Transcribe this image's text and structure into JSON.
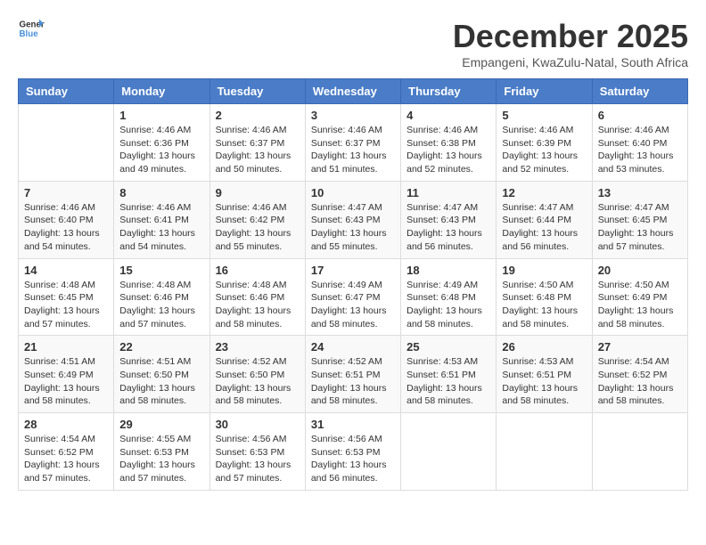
{
  "logo": {
    "general": "General",
    "blue": "Blue"
  },
  "title": "December 2025",
  "location": "Empangeni, KwaZulu-Natal, South Africa",
  "headers": [
    "Sunday",
    "Monday",
    "Tuesday",
    "Wednesday",
    "Thursday",
    "Friday",
    "Saturday"
  ],
  "weeks": [
    [
      {
        "day": "",
        "sunrise": "",
        "sunset": "",
        "daylight": ""
      },
      {
        "day": "1",
        "sunrise": "Sunrise: 4:46 AM",
        "sunset": "Sunset: 6:36 PM",
        "daylight": "Daylight: 13 hours and 49 minutes."
      },
      {
        "day": "2",
        "sunrise": "Sunrise: 4:46 AM",
        "sunset": "Sunset: 6:37 PM",
        "daylight": "Daylight: 13 hours and 50 minutes."
      },
      {
        "day": "3",
        "sunrise": "Sunrise: 4:46 AM",
        "sunset": "Sunset: 6:37 PM",
        "daylight": "Daylight: 13 hours and 51 minutes."
      },
      {
        "day": "4",
        "sunrise": "Sunrise: 4:46 AM",
        "sunset": "Sunset: 6:38 PM",
        "daylight": "Daylight: 13 hours and 52 minutes."
      },
      {
        "day": "5",
        "sunrise": "Sunrise: 4:46 AM",
        "sunset": "Sunset: 6:39 PM",
        "daylight": "Daylight: 13 hours and 52 minutes."
      },
      {
        "day": "6",
        "sunrise": "Sunrise: 4:46 AM",
        "sunset": "Sunset: 6:40 PM",
        "daylight": "Daylight: 13 hours and 53 minutes."
      }
    ],
    [
      {
        "day": "7",
        "sunrise": "Sunrise: 4:46 AM",
        "sunset": "Sunset: 6:40 PM",
        "daylight": "Daylight: 13 hours and 54 minutes."
      },
      {
        "day": "8",
        "sunrise": "Sunrise: 4:46 AM",
        "sunset": "Sunset: 6:41 PM",
        "daylight": "Daylight: 13 hours and 54 minutes."
      },
      {
        "day": "9",
        "sunrise": "Sunrise: 4:46 AM",
        "sunset": "Sunset: 6:42 PM",
        "daylight": "Daylight: 13 hours and 55 minutes."
      },
      {
        "day": "10",
        "sunrise": "Sunrise: 4:47 AM",
        "sunset": "Sunset: 6:43 PM",
        "daylight": "Daylight: 13 hours and 55 minutes."
      },
      {
        "day": "11",
        "sunrise": "Sunrise: 4:47 AM",
        "sunset": "Sunset: 6:43 PM",
        "daylight": "Daylight: 13 hours and 56 minutes."
      },
      {
        "day": "12",
        "sunrise": "Sunrise: 4:47 AM",
        "sunset": "Sunset: 6:44 PM",
        "daylight": "Daylight: 13 hours and 56 minutes."
      },
      {
        "day": "13",
        "sunrise": "Sunrise: 4:47 AM",
        "sunset": "Sunset: 6:45 PM",
        "daylight": "Daylight: 13 hours and 57 minutes."
      }
    ],
    [
      {
        "day": "14",
        "sunrise": "Sunrise: 4:48 AM",
        "sunset": "Sunset: 6:45 PM",
        "daylight": "Daylight: 13 hours and 57 minutes."
      },
      {
        "day": "15",
        "sunrise": "Sunrise: 4:48 AM",
        "sunset": "Sunset: 6:46 PM",
        "daylight": "Daylight: 13 hours and 57 minutes."
      },
      {
        "day": "16",
        "sunrise": "Sunrise: 4:48 AM",
        "sunset": "Sunset: 6:46 PM",
        "daylight": "Daylight: 13 hours and 58 minutes."
      },
      {
        "day": "17",
        "sunrise": "Sunrise: 4:49 AM",
        "sunset": "Sunset: 6:47 PM",
        "daylight": "Daylight: 13 hours and 58 minutes."
      },
      {
        "day": "18",
        "sunrise": "Sunrise: 4:49 AM",
        "sunset": "Sunset: 6:48 PM",
        "daylight": "Daylight: 13 hours and 58 minutes."
      },
      {
        "day": "19",
        "sunrise": "Sunrise: 4:50 AM",
        "sunset": "Sunset: 6:48 PM",
        "daylight": "Daylight: 13 hours and 58 minutes."
      },
      {
        "day": "20",
        "sunrise": "Sunrise: 4:50 AM",
        "sunset": "Sunset: 6:49 PM",
        "daylight": "Daylight: 13 hours and 58 minutes."
      }
    ],
    [
      {
        "day": "21",
        "sunrise": "Sunrise: 4:51 AM",
        "sunset": "Sunset: 6:49 PM",
        "daylight": "Daylight: 13 hours and 58 minutes."
      },
      {
        "day": "22",
        "sunrise": "Sunrise: 4:51 AM",
        "sunset": "Sunset: 6:50 PM",
        "daylight": "Daylight: 13 hours and 58 minutes."
      },
      {
        "day": "23",
        "sunrise": "Sunrise: 4:52 AM",
        "sunset": "Sunset: 6:50 PM",
        "daylight": "Daylight: 13 hours and 58 minutes."
      },
      {
        "day": "24",
        "sunrise": "Sunrise: 4:52 AM",
        "sunset": "Sunset: 6:51 PM",
        "daylight": "Daylight: 13 hours and 58 minutes."
      },
      {
        "day": "25",
        "sunrise": "Sunrise: 4:53 AM",
        "sunset": "Sunset: 6:51 PM",
        "daylight": "Daylight: 13 hours and 58 minutes."
      },
      {
        "day": "26",
        "sunrise": "Sunrise: 4:53 AM",
        "sunset": "Sunset: 6:51 PM",
        "daylight": "Daylight: 13 hours and 58 minutes."
      },
      {
        "day": "27",
        "sunrise": "Sunrise: 4:54 AM",
        "sunset": "Sunset: 6:52 PM",
        "daylight": "Daylight: 13 hours and 58 minutes."
      }
    ],
    [
      {
        "day": "28",
        "sunrise": "Sunrise: 4:54 AM",
        "sunset": "Sunset: 6:52 PM",
        "daylight": "Daylight: 13 hours and 57 minutes."
      },
      {
        "day": "29",
        "sunrise": "Sunrise: 4:55 AM",
        "sunset": "Sunset: 6:53 PM",
        "daylight": "Daylight: 13 hours and 57 minutes."
      },
      {
        "day": "30",
        "sunrise": "Sunrise: 4:56 AM",
        "sunset": "Sunset: 6:53 PM",
        "daylight": "Daylight: 13 hours and 57 minutes."
      },
      {
        "day": "31",
        "sunrise": "Sunrise: 4:56 AM",
        "sunset": "Sunset: 6:53 PM",
        "daylight": "Daylight: 13 hours and 56 minutes."
      },
      {
        "day": "",
        "sunrise": "",
        "sunset": "",
        "daylight": ""
      },
      {
        "day": "",
        "sunrise": "",
        "sunset": "",
        "daylight": ""
      },
      {
        "day": "",
        "sunrise": "",
        "sunset": "",
        "daylight": ""
      }
    ]
  ]
}
